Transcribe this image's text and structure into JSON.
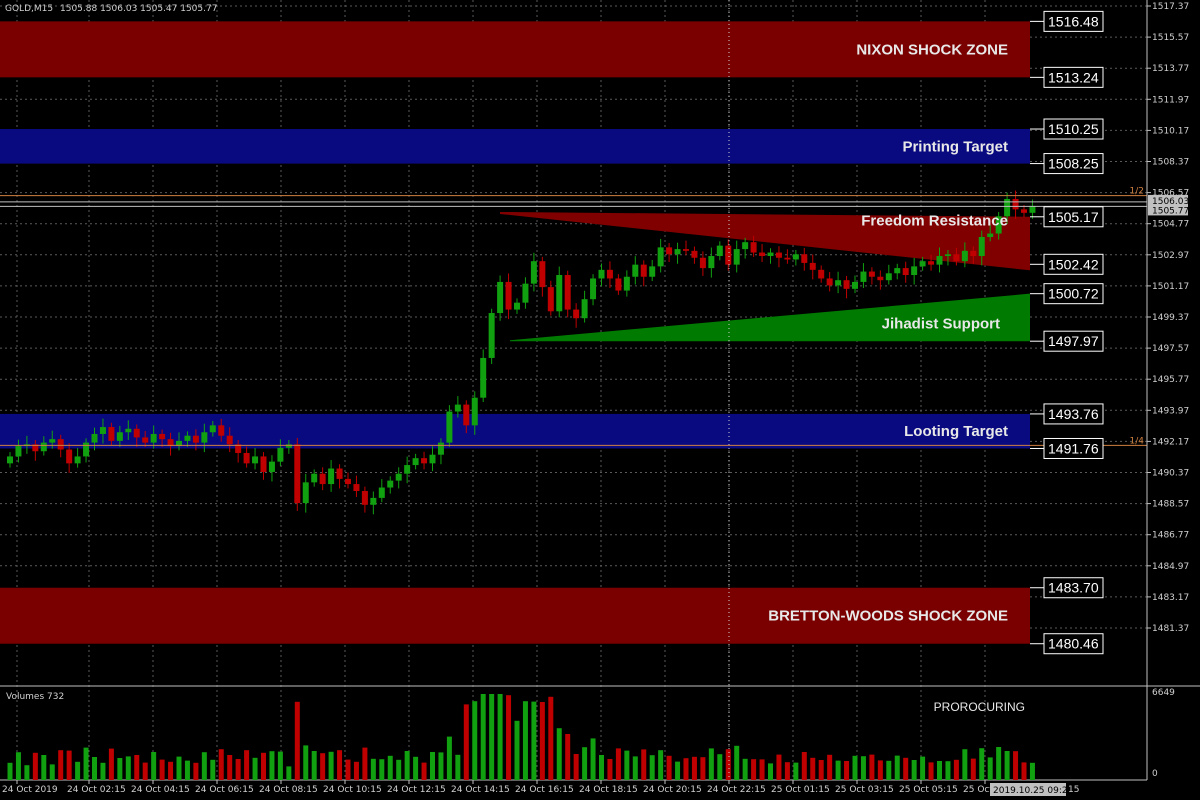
{
  "header": {
    "symbol": "GOLD,M15",
    "ohlc": "1505.88 1506.03 1505.47 1505.77"
  },
  "colors": {
    "background": "#000000",
    "grid": "#5a5a5a",
    "bull": "#10a010",
    "bear": "#c00000",
    "red_zone": "#7a0000",
    "blue_zone": "#0a0a80",
    "green_wedge": "#007a00"
  },
  "zones": [
    {
      "name": "NIXON SHOCK ZONE",
      "color": "red_zone",
      "high": 1516.48,
      "low": 1513.24,
      "high_label": "1516.48",
      "low_label": "1513.24"
    },
    {
      "name": "Printing Target",
      "color": "blue_zone",
      "high": 1510.25,
      "low": 1508.25,
      "high_label": "1510.25",
      "low_label": "1508.25"
    },
    {
      "name": "Looting Target",
      "color": "blue_zone",
      "high": 1493.76,
      "low": 1491.76,
      "high_label": "1493.76",
      "low_label": "1491.76"
    },
    {
      "name": "BRETTON-WOODS SHOCK ZONE",
      "color": "red_zone",
      "high": 1483.7,
      "low": 1480.46,
      "high_label": "1483.70",
      "low_label": "1480.46"
    }
  ],
  "wedges": [
    {
      "name": "Freedom Resistance",
      "level_labels": [
        "1505.17",
        "1502.42"
      ],
      "levels": [
        1505.17,
        1502.42
      ]
    },
    {
      "name": "Jihadist Support",
      "level_labels": [
        "1500.72",
        "1497.97"
      ],
      "levels": [
        1500.72,
        1497.97
      ]
    }
  ],
  "price_axis": {
    "ticks": [
      "1517.37",
      "1515.57",
      "1513.77",
      "1511.97",
      "1510.17",
      "1508.37",
      "1506.57",
      "1504.77",
      "1502.97",
      "1501.17",
      "1499.37",
      "1497.57",
      "1495.77",
      "1493.97",
      "1492.17",
      "1490.37",
      "1488.57",
      "1486.77",
      "1484.97",
      "1483.17",
      "1481.37"
    ],
    "current_price_labels": [
      "1506.03",
      "1505.77"
    ]
  },
  "fib_tags": [
    "1/2",
    "1/4"
  ],
  "time_axis": [
    "24 Oct 2019",
    "24 Oct 02:15",
    "24 Oct 04:15",
    "24 Oct 06:15",
    "24 Oct 08:15",
    "24 Oct 10:15",
    "24 Oct 12:15",
    "24 Oct 14:15",
    "24 Oct 16:15",
    "24 Oct 18:15",
    "24 Oct 20:15",
    "24 Oct 22:15",
    "25 Oct 01:15",
    "25 Oct 03:15",
    "25 Oct 05:15",
    "25 Oct"
  ],
  "crosshair_time": "2019.10.25 09:21",
  "crosshair_time_suffix": "15",
  "volume": {
    "label": "Volumes 732",
    "top_tick": "6649",
    "bottom_tick": "0",
    "indicator": "PROROCURING"
  },
  "chart_data": {
    "type": "candlestick",
    "closes": [
      1491.3,
      1491.9,
      1492.0,
      1491.6,
      1492.1,
      1492.3,
      1491.7,
      1490.9,
      1491.3,
      1492.1,
      1492.6,
      1493.0,
      1492.2,
      1492.7,
      1492.9,
      1492.4,
      1492.1,
      1492.6,
      1492.3,
      1491.9,
      1492.2,
      1492.5,
      1492.1,
      1492.7,
      1493.1,
      1492.5,
      1492.0,
      1491.5,
      1490.9,
      1491.3,
      1490.4,
      1491.0,
      1491.8,
      1492.0,
      1488.6,
      1489.8,
      1490.3,
      1489.7,
      1490.6,
      1490.0,
      1489.7,
      1489.3,
      1488.5,
      1488.9,
      1489.5,
      1489.9,
      1490.3,
      1490.8,
      1491.2,
      1490.9,
      1491.4,
      1492.1,
      1493.9,
      1494.3,
      1493.1,
      1494.7,
      1497.0,
      1499.6,
      1501.4,
      1499.8,
      1500.2,
      1501.3,
      1502.6,
      1501.1,
      1499.7,
      1501.8,
      1499.8,
      1499.3,
      1500.4,
      1501.6,
      1502.1,
      1501.6,
      1500.9,
      1501.7,
      1502.4,
      1501.7,
      1502.3,
      1503.4,
      1503.0,
      1503.3,
      1503.2,
      1502.8,
      1502.2,
      1502.9,
      1503.5,
      1502.4,
      1503.3,
      1503.7,
      1503.1,
      1502.9,
      1503.1,
      1502.8,
      1502.7,
      1503.0,
      1502.5,
      1502.1,
      1501.6,
      1501.2,
      1501.5,
      1501.0,
      1501.4,
      1502.0,
      1501.7,
      1501.5,
      1501.9,
      1502.2,
      1501.8,
      1502.3,
      1502.6,
      1502.4,
      1502.9,
      1503.0,
      1502.6,
      1503.2,
      1502.9,
      1504.0,
      1504.2,
      1505.2,
      1506.2,
      1505.6,
      1505.4,
      1505.8
    ]
  }
}
